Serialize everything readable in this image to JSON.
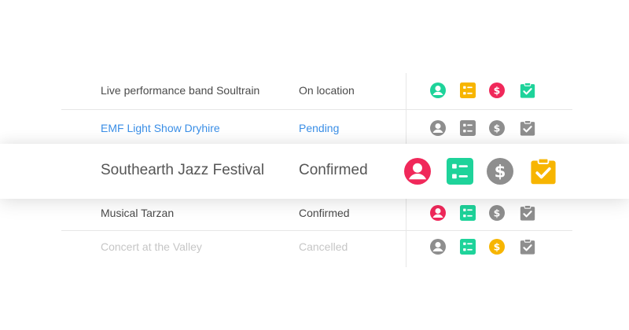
{
  "rows": [
    {
      "name": "Live performance band Soultrain",
      "status": "On location",
      "text_color": "#4a4a4a",
      "icon_colors": [
        "#1ed39a",
        "#f7b500",
        "#f0285a",
        "#1ed39a"
      ]
    },
    {
      "name": "EMF Light Show Dryhire",
      "status": "Pending",
      "text_color": "#3a8ee6",
      "icon_colors": [
        "#8e8e8e",
        "#8e8e8e",
        "#8e8e8e",
        "#8e8e8e"
      ]
    },
    {
      "name": "Southearth Jazz Festival",
      "status": "Confirmed",
      "text_color": "#555555",
      "icon_colors": [
        "#f0285a",
        "#1ed39a",
        "#8e8e8e",
        "#f7b500"
      ]
    },
    {
      "name": "Musical Tarzan",
      "status": "Confirmed",
      "text_color": "#4a4a4a",
      "icon_colors": [
        "#f0285a",
        "#1ed39a",
        "#8e8e8e",
        "#8e8e8e"
      ]
    },
    {
      "name": "Concert at the Valley",
      "status": "Cancelled",
      "text_color": "#c6c6c6",
      "icon_colors": [
        "#8e8e8e",
        "#1ed39a",
        "#f7b500",
        "#8e8e8e"
      ]
    }
  ],
  "icon_names": [
    "person-icon",
    "checklist-icon",
    "dollar-icon",
    "clipboard-check-icon"
  ]
}
